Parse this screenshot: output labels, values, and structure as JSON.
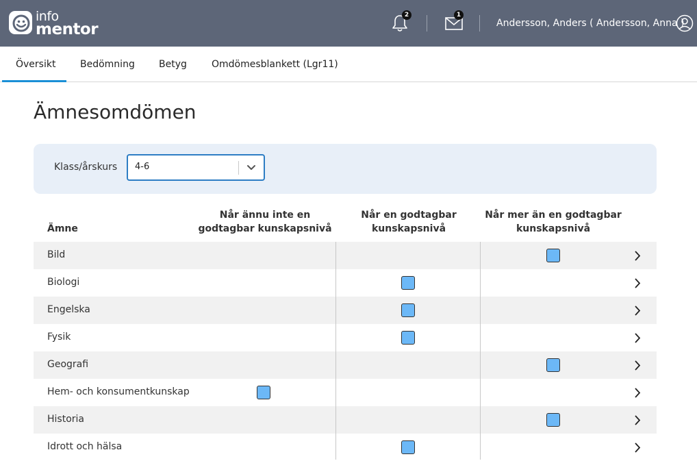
{
  "header": {
    "logo_line1": "info",
    "logo_line2": "mentor",
    "notifications_count": "2",
    "messages_count": "1",
    "user_name": "Andersson, Anders ( Andersson, Anna )"
  },
  "tabs": [
    {
      "label": "Översikt",
      "active": true
    },
    {
      "label": "Bedömning",
      "active": false
    },
    {
      "label": "Betyg",
      "active": false
    },
    {
      "label": "Omdömesblankett (Lgr11)",
      "active": false
    }
  ],
  "page_title": "Ämnesomdömen",
  "filter": {
    "label": "Klass/årskurs",
    "selected": "4-6"
  },
  "table": {
    "columns": {
      "subject": "Ämne",
      "level1": "Når ännu inte en godtagbar kunskapsnivå",
      "level2": "Når en godtagbar kunskapsnivå",
      "level3": "Når mer än en godtagbar kunskapsnivå"
    },
    "rows": [
      {
        "subject": "Bild",
        "level": 3
      },
      {
        "subject": "Biologi",
        "level": 2
      },
      {
        "subject": "Engelska",
        "level": 2
      },
      {
        "subject": "Fysik",
        "level": 2
      },
      {
        "subject": "Geografi",
        "level": 3
      },
      {
        "subject": "Hem- och konsumentkunskap",
        "level": 1
      },
      {
        "subject": "Historia",
        "level": 3
      },
      {
        "subject": "Idrott och hälsa",
        "level": 2
      }
    ]
  },
  "colors": {
    "header_bg": "#5d6678",
    "accent": "#1a8fd6",
    "mark_fill": "#6cb8f7",
    "filter_bg": "#e8eff8"
  },
  "icons": [
    "bell-icon",
    "mail-icon",
    "user-icon",
    "chevron-down-icon",
    "chevron-right-icon"
  ]
}
